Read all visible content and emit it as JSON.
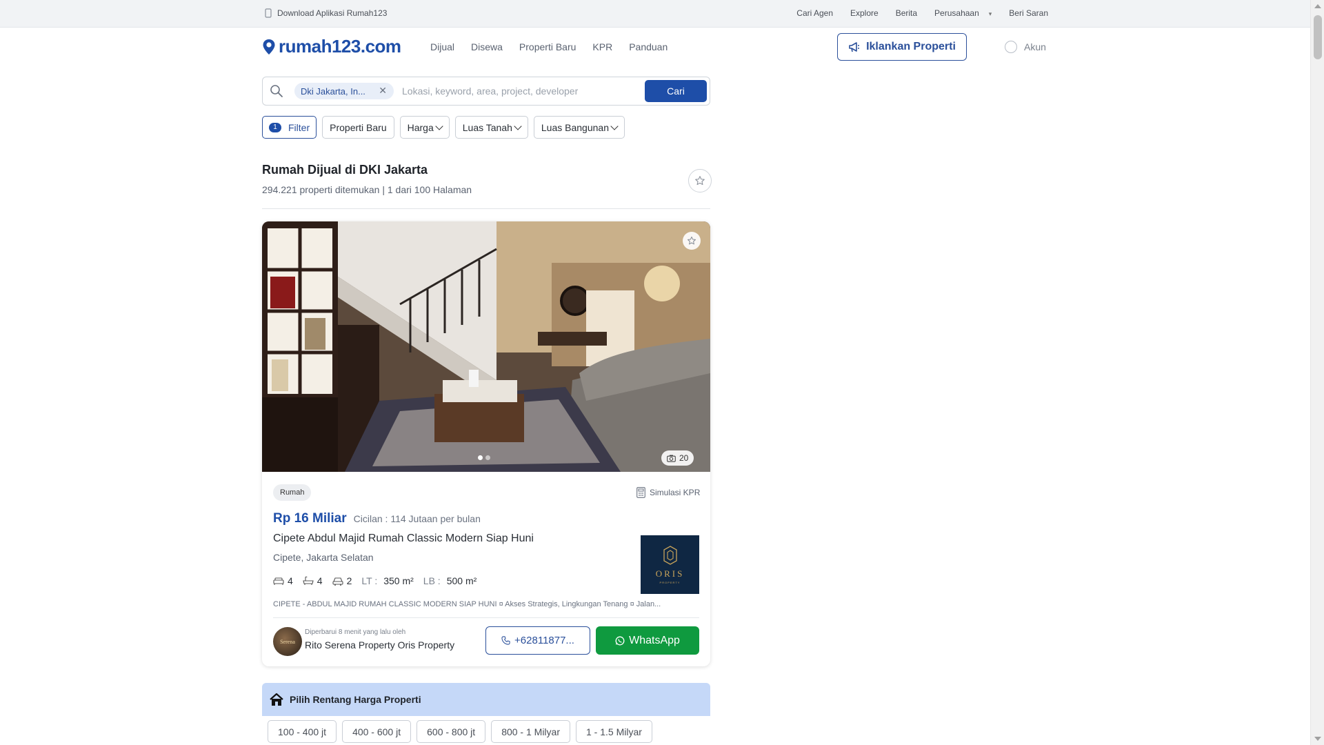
{
  "topbar": {
    "download": "Download Aplikasi Rumah123",
    "links": [
      "Cari Agen",
      "Explore",
      "Berita",
      "Perusahaan",
      "Beri Saran"
    ]
  },
  "header": {
    "logo": "rumah123.com",
    "nav": [
      "Dijual",
      "Disewa",
      "Properti Baru",
      "KPR",
      "Panduan"
    ],
    "advertise_label": "Iklankan Properti",
    "account_label": "Akun"
  },
  "search": {
    "location_chip": "Dki Jakarta, In...",
    "placeholder": "Lokasi, keyword, area, project, developer",
    "submit_label": "Cari"
  },
  "filters": {
    "filter_count": "1",
    "filter_label": "Filter",
    "items": [
      "Properti Baru",
      "Harga",
      "Luas Tanah",
      "Luas Bangunan"
    ]
  },
  "results": {
    "title": "Rumah Dijual di DKI Jakarta",
    "summary": "294.221 properti ditemukan | 1 dari 100 Halaman"
  },
  "listing": {
    "photo_count": "20",
    "photo_dots_total": 2,
    "photo_dot_active": 0,
    "type": "Rumah",
    "simulasi_label": "Simulasi KPR",
    "price": "Rp 16 Miliar",
    "installment": "Cicilan : 114 Jutaan per bulan",
    "title": "Cipete Abdul Majid Rumah Classic Modern Siap Huni",
    "location": "Cipete, Jakarta Selatan",
    "bedrooms": "4",
    "bathrooms": "4",
    "garage": "2",
    "lt_label": "LT :",
    "lt_value": "350 m²",
    "lb_label": "LB :",
    "lb_value": "500 m²",
    "description": "CIPETE - ABDUL MAJID RUMAH CLASSIC MODERN SIAP HUNI ¤ Akses Strategis, Lingkungan Tenang ¤ Jalan...",
    "agency_logo_text": "ORIS",
    "agency_logo_sub": "PROPERTY",
    "agent_avatar_text": "Serena",
    "updated": "Diperbarui 8 menit yang lalu oleh",
    "agent_name": "Rito Serena Property Oris Property",
    "phone_label": "+62811877...",
    "whatsapp_label": "WhatsApp"
  },
  "price_range": {
    "title": "Pilih Rentang Harga Properti",
    "options": [
      "100 - 400 jt",
      "400 - 600 jt",
      "600 - 800 jt",
      "800 - 1 Milyar",
      "1 - 1.5 Milyar"
    ]
  },
  "colors": {
    "brand_blue": "#1e4ea8",
    "whatsapp_green": "#0f9a3f",
    "range_header_bg": "#c5d8f8"
  }
}
